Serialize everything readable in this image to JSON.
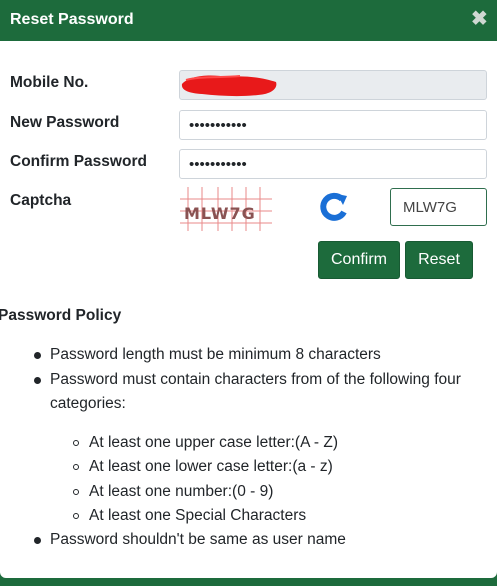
{
  "dialog": {
    "title": "Reset Password",
    "close_glyph": "✖"
  },
  "form": {
    "mobile_label": "Mobile No.",
    "new_password_label": "New Password",
    "new_password_value": "•••••••••••",
    "confirm_password_label": "Confirm Password",
    "confirm_password_value": "•••••••••••",
    "captcha_label": "Captcha",
    "captcha_image_text": "MLW7G",
    "captcha_input_value": "MLW7G"
  },
  "buttons": {
    "confirm_label": "Confirm",
    "reset_label": "Reset"
  },
  "policy": {
    "title": "Password Policy",
    "item1": "Password length must be minimum 8 characters",
    "item2_line1": "Password must contain characters from of the following four",
    "item2_line2": "categories:",
    "sub1": "At least one upper case letter:(A - Z)",
    "sub2": "At least one lower case letter:(a - z)",
    "sub3": "At least one number:(0 - 9)",
    "sub4": "At least one Special Characters",
    "item3": "Password shouldn't be same as user name"
  },
  "colors": {
    "header_bg": "#1d6b3c",
    "button_bg": "#1d6b3c",
    "redaction": "#e8191a",
    "refresh_icon": "#1a6fd6"
  },
  "icons": {
    "close": "close-icon",
    "refresh": "refresh-icon"
  }
}
